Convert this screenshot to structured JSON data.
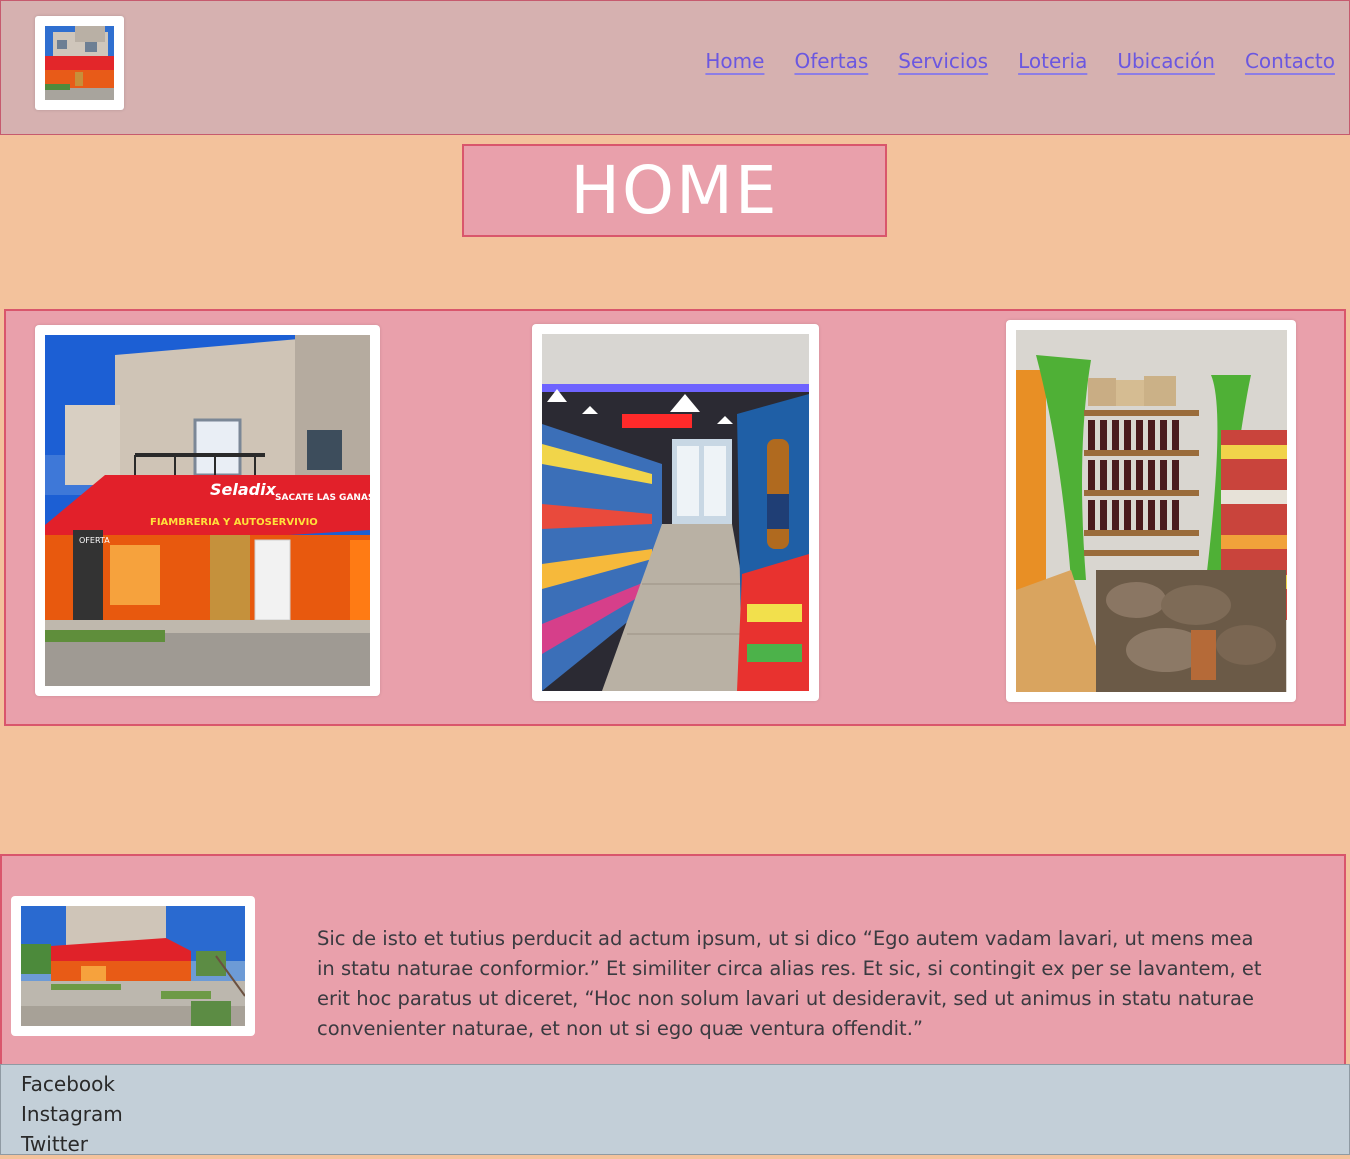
{
  "header": {
    "logo_alt": "store logo",
    "nav": [
      "Home",
      "Ofertas",
      "Servicios",
      "Loteria",
      "Ubicación",
      "Contacto"
    ]
  },
  "main": {
    "title": "HOME"
  },
  "gallery": {
    "photos": [
      {
        "subject": "store-front-photo",
        "sign_brand": "Seladix",
        "sign_slogan": "SACATE LAS GANAS",
        "sign_text": "FIAMBRERIA Y AUTOSERVIVIO",
        "side_sign": "OFERTA"
      },
      {
        "subject": "store-aisle-photo"
      },
      {
        "subject": "wine-shelf-photo"
      }
    ]
  },
  "info": {
    "text": "Sic de isto et tutius perducit ad actum ipsum, ut si dico “Ego autem vadam lavari, ut mens mea in statu naturae conformior.” Et similiter circa alias res. Et sic, si contingit ex per se lavantem, et erit hoc paratus ut diceret, “Hoc non solum lavari ut desideravit, sed ut animus in statu naturae convenienter naturae, et non ut si ego quæ ventura offendit.”"
  },
  "footer": {
    "links": [
      "Facebook",
      "Instagram",
      "Twitter"
    ]
  },
  "colors": {
    "page_bg": "#f3c29c",
    "header_bg": "#d6b1b0",
    "panel_bg": "#e9a0ab",
    "panel_border": "#d9566c",
    "nav_link": "#6b57e0",
    "footer_bg": "#c3cfd8"
  }
}
